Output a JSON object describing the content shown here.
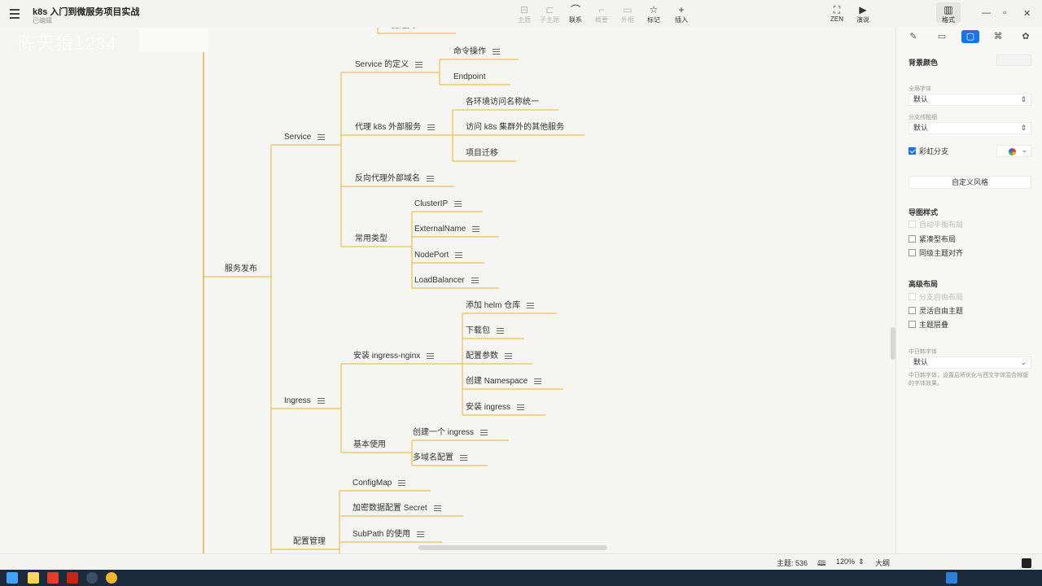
{
  "app": {
    "title": "k8s 入门到微服务项目实战",
    "status": "已编辑"
  },
  "toolbar": [
    {
      "label": "主题",
      "glyph": "⊟",
      "enabled": false
    },
    {
      "label": "子主题",
      "glyph": "⊏",
      "enabled": false
    },
    {
      "label": "联系",
      "glyph": "⌒",
      "enabled": true
    },
    {
      "label": "概要",
      "glyph": "⌐",
      "enabled": false
    },
    {
      "label": "外框",
      "glyph": "▭",
      "enabled": false
    },
    {
      "label": "标记",
      "glyph": "☆",
      "enabled": true
    },
    {
      "label": "插入",
      "glyph": "+",
      "enabled": true
    }
  ],
  "toolbar_right": [
    {
      "label": "ZEN",
      "glyph": "⛶"
    },
    {
      "label": "演说",
      "glyph": "▶"
    }
  ],
  "format_button": {
    "label": "格式",
    "glyph": "▥"
  },
  "watermark": "陈天狼1234",
  "mindmap": {
    "nodes": [
      {
        "id": "fabu",
        "text": "服务发布",
        "note": false
      },
      {
        "id": "service",
        "text": "Service",
        "note": true
      },
      {
        "id": "svc-def",
        "text": "Service 的定义",
        "note": true
      },
      {
        "id": "cmd",
        "text": "命令操作",
        "note": true
      },
      {
        "id": "endpoint",
        "text": "Endpoint",
        "note": false
      },
      {
        "id": "proxy-ext",
        "text": "代理 k8s 外部服务",
        "note": true
      },
      {
        "id": "env-name",
        "text": "各环境访问名称统一",
        "note": false
      },
      {
        "id": "access-other",
        "text": "访问 k8s 集群外的其他服务",
        "note": false
      },
      {
        "id": "migrate",
        "text": "项目迁移",
        "note": false
      },
      {
        "id": "rev-proxy",
        "text": "反向代理外部域名",
        "note": true
      },
      {
        "id": "types",
        "text": "常用类型",
        "note": false
      },
      {
        "id": "clusterip",
        "text": "ClusterIP",
        "note": true
      },
      {
        "id": "externalname",
        "text": "ExternalName",
        "note": true
      },
      {
        "id": "nodeport",
        "text": "NodePort",
        "note": true
      },
      {
        "id": "loadbalancer",
        "text": "LoadBalancer",
        "note": true
      },
      {
        "id": "ingress",
        "text": "Ingress",
        "note": true
      },
      {
        "id": "install-ngx",
        "text": "安装 ingress-nginx",
        "note": true
      },
      {
        "id": "helm-repo",
        "text": "添加 helm 仓库",
        "note": true
      },
      {
        "id": "download",
        "text": "下载包",
        "note": true
      },
      {
        "id": "params",
        "text": "配置参数",
        "note": true
      },
      {
        "id": "namespace",
        "text": "创建 Namespace",
        "note": true
      },
      {
        "id": "install-ing",
        "text": "安装 ingress",
        "note": true
      },
      {
        "id": "basic-use",
        "text": "基本使用",
        "note": false
      },
      {
        "id": "create-ing",
        "text": "创建一个 ingress",
        "note": true
      },
      {
        "id": "multi-domain",
        "text": "多域名配置",
        "note": true
      },
      {
        "id": "configmap",
        "text": "ConfigMap",
        "note": true
      },
      {
        "id": "secret",
        "text": "加密数据配置 Secret",
        "note": true
      },
      {
        "id": "subpath",
        "text": "SubPath 的使用",
        "note": true
      },
      {
        "id": "config-mgmt",
        "text": "配置管理",
        "note": false
      },
      {
        "id": "cut-top",
        "text": "自建文 Metrics",
        "note": false
      }
    ]
  },
  "panel": {
    "tabs": [
      "✎",
      "▭",
      "▢",
      "⌘",
      "✿"
    ],
    "bg_color_label": "背景颜色",
    "global_font_label": "全局字体",
    "global_font_value": "默认",
    "branch_thickness_label": "分支线粗细",
    "branch_thickness_value": "默认",
    "rainbow_label": "彩虹分支",
    "rainbow_checked": true,
    "custom_style_label": "自定义风格",
    "map_style_title": "导图样式",
    "map_style_options": [
      {
        "label": "自动平衡布局",
        "disabled": true,
        "checked": false
      },
      {
        "label": "紧凑型布局",
        "disabled": false,
        "checked": false
      },
      {
        "label": "同级主题对齐",
        "disabled": false,
        "checked": false
      }
    ],
    "advanced_title": "高级布局",
    "advanced_options": [
      {
        "label": "分支自由布局",
        "disabled": true,
        "checked": false
      },
      {
        "label": "灵活自由主题",
        "disabled": false,
        "checked": false
      },
      {
        "label": "主题层叠",
        "disabled": false,
        "checked": false
      }
    ],
    "cjk_font_label": "中日韩字体",
    "cjk_font_value": "默认",
    "cjk_font_desc": "中日韩字体，设置后将优化与西文字体混合排版的字体效果。"
  },
  "statusbar": {
    "topics_label": "主题: 536",
    "zoom": "120%",
    "outline_label": "大纲"
  },
  "colors": {
    "branch": "#e8b82a",
    "main_line": "#e2a91b",
    "accent": "#1b73e8"
  }
}
